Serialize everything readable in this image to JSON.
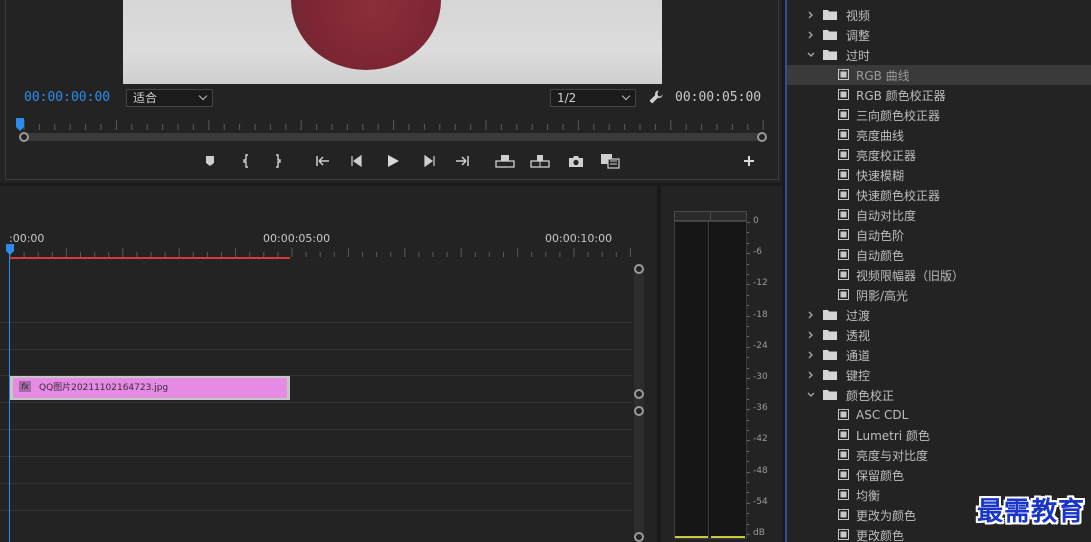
{
  "monitor": {
    "current_timecode": "00:00:00:00",
    "duration_timecode": "00:00:05:00",
    "fit_select": "适合",
    "resolution_select": "1/2",
    "transport": [
      {
        "name": "add-marker-button",
        "icon": "marker-icon"
      },
      {
        "name": "mark-in-button",
        "icon": "mark-in-icon"
      },
      {
        "name": "mark-out-button",
        "icon": "mark-out-icon"
      },
      {
        "name": "go-to-in-button",
        "icon": "go-to-in-icon"
      },
      {
        "name": "step-back-button",
        "icon": "step-back-icon"
      },
      {
        "name": "play-button",
        "icon": "play-icon"
      },
      {
        "name": "step-forward-button",
        "icon": "step-forward-icon"
      },
      {
        "name": "go-to-out-button",
        "icon": "go-to-out-icon"
      },
      {
        "name": "lift-button",
        "icon": "lift-icon"
      },
      {
        "name": "extract-button",
        "icon": "extract-icon"
      },
      {
        "name": "export-frame-button",
        "icon": "camera-icon"
      },
      {
        "name": "comparison-view-button",
        "icon": "comparison-icon"
      },
      {
        "name": "button-editor-button",
        "icon": "plus-icon"
      }
    ]
  },
  "timeline": {
    "ruler_labels": [
      ":00:00",
      "00:00:05:00",
      "00:00:10:00"
    ],
    "clip": {
      "fx_badge": "fx",
      "name": "QQ图片20211102164723.jpg",
      "color": "#e68be4"
    }
  },
  "meter": {
    "scale": [
      "0",
      "-6",
      "-12",
      "-18",
      "-24",
      "-30",
      "-36",
      "-42",
      "-48",
      "-54",
      "dB"
    ]
  },
  "effects": {
    "items": [
      {
        "type": "folder",
        "expanded": false,
        "label": "视频",
        "level": 1
      },
      {
        "type": "folder",
        "expanded": false,
        "label": "调整",
        "level": 1
      },
      {
        "type": "folder",
        "expanded": true,
        "label": "过时",
        "level": 1
      },
      {
        "type": "effect",
        "label": "RGB 曲线",
        "level": 2,
        "selected": true
      },
      {
        "type": "effect",
        "label": "RGB 颜色校正器",
        "level": 2
      },
      {
        "type": "effect",
        "label": "三向颜色校正器",
        "level": 2
      },
      {
        "type": "effect",
        "label": "亮度曲线",
        "level": 2
      },
      {
        "type": "effect",
        "label": "亮度校正器",
        "level": 2
      },
      {
        "type": "effect",
        "label": "快速模糊",
        "level": 2
      },
      {
        "type": "effect",
        "label": "快速颜色校正器",
        "level": 2
      },
      {
        "type": "effect",
        "label": "自动对比度",
        "level": 2
      },
      {
        "type": "effect",
        "label": "自动色阶",
        "level": 2
      },
      {
        "type": "effect",
        "label": "自动颜色",
        "level": 2
      },
      {
        "type": "effect",
        "label": "视频限幅器（旧版）",
        "level": 2
      },
      {
        "type": "effect",
        "label": "阴影/高光",
        "level": 2
      },
      {
        "type": "folder",
        "expanded": false,
        "label": "过渡",
        "level": 1
      },
      {
        "type": "folder",
        "expanded": false,
        "label": "透视",
        "level": 1
      },
      {
        "type": "folder",
        "expanded": false,
        "label": "通道",
        "level": 1
      },
      {
        "type": "folder",
        "expanded": false,
        "label": "键控",
        "level": 1
      },
      {
        "type": "folder",
        "expanded": true,
        "label": "颜色校正",
        "level": 1
      },
      {
        "type": "effect",
        "label": "ASC CDL",
        "level": 2
      },
      {
        "type": "effect",
        "label": "Lumetri 颜色",
        "level": 2
      },
      {
        "type": "effect",
        "label": "亮度与对比度",
        "level": 2
      },
      {
        "type": "effect",
        "label": "保留颜色",
        "level": 2
      },
      {
        "type": "effect",
        "label": "均衡",
        "level": 2
      },
      {
        "type": "effect",
        "label": "更改为颜色",
        "level": 2
      },
      {
        "type": "effect",
        "label": "更改颜色",
        "level": 2
      }
    ]
  },
  "watermark": "最需教育",
  "colors": {
    "accent_blue": "#2d8ceb",
    "work_area_red": "#d63a3a",
    "panel_focus": "#2f4f9a"
  }
}
